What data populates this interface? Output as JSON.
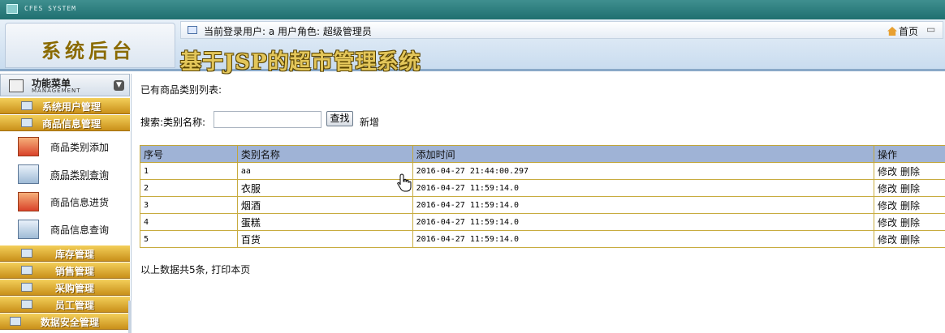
{
  "window": {
    "title": "CFES SYSTEM"
  },
  "header": {
    "logo": "系统后台",
    "user_info": "当前登录用户: a   用户角色: 超级管理员",
    "home_label": "首页",
    "system_title": "基于JSP的超市管理系统"
  },
  "sidebar": {
    "title": "功能菜单",
    "subtitle": "MANAGEMENT",
    "categories_top": [
      {
        "label": "系统用户管理"
      },
      {
        "label": "商品信息管理"
      }
    ],
    "sub_items": [
      {
        "label": "商品类别添加",
        "icon": "red-form-icon"
      },
      {
        "label": "商品类别查询",
        "icon": "blue-list-icon"
      },
      {
        "label": "商品信息进货",
        "icon": "red-form-icon"
      },
      {
        "label": "商品信息查询",
        "icon": "blue-list-icon"
      }
    ],
    "categories_bottom": [
      {
        "label": "库存管理"
      },
      {
        "label": "销售管理"
      },
      {
        "label": "采购管理"
      },
      {
        "label": "员工管理"
      },
      {
        "label": "数据安全管理"
      }
    ]
  },
  "main": {
    "list_title": "已有商品类别列表:",
    "search_label": "搜索:类别名称:",
    "search_value": "",
    "search_button": "查找",
    "add_link": "新增",
    "columns": [
      "序号",
      "类别名称",
      "添加时间",
      "操作"
    ],
    "rows": [
      {
        "id": "1",
        "name": "aa",
        "time": "2016-04-27 21:44:00.297",
        "edit": "修改",
        "delete": "删除"
      },
      {
        "id": "2",
        "name": "衣服",
        "time": "2016-04-27 11:59:14.0",
        "edit": "修改",
        "delete": "删除"
      },
      {
        "id": "3",
        "name": "烟酒",
        "time": "2016-04-27 11:59:14.0",
        "edit": "修改",
        "delete": "删除"
      },
      {
        "id": "4",
        "name": "蛋糕",
        "time": "2016-04-27 11:59:14.0",
        "edit": "修改",
        "delete": "删除"
      },
      {
        "id": "5",
        "name": "百货",
        "time": "2016-04-27 11:59:14.0",
        "edit": "修改",
        "delete": "删除"
      }
    ],
    "footer": "以上数据共5条, 打印本页"
  },
  "colors": {
    "menu_gold": "#c9901a",
    "header_blue": "#9fb3d6",
    "title_bar": "#1f6f70"
  }
}
